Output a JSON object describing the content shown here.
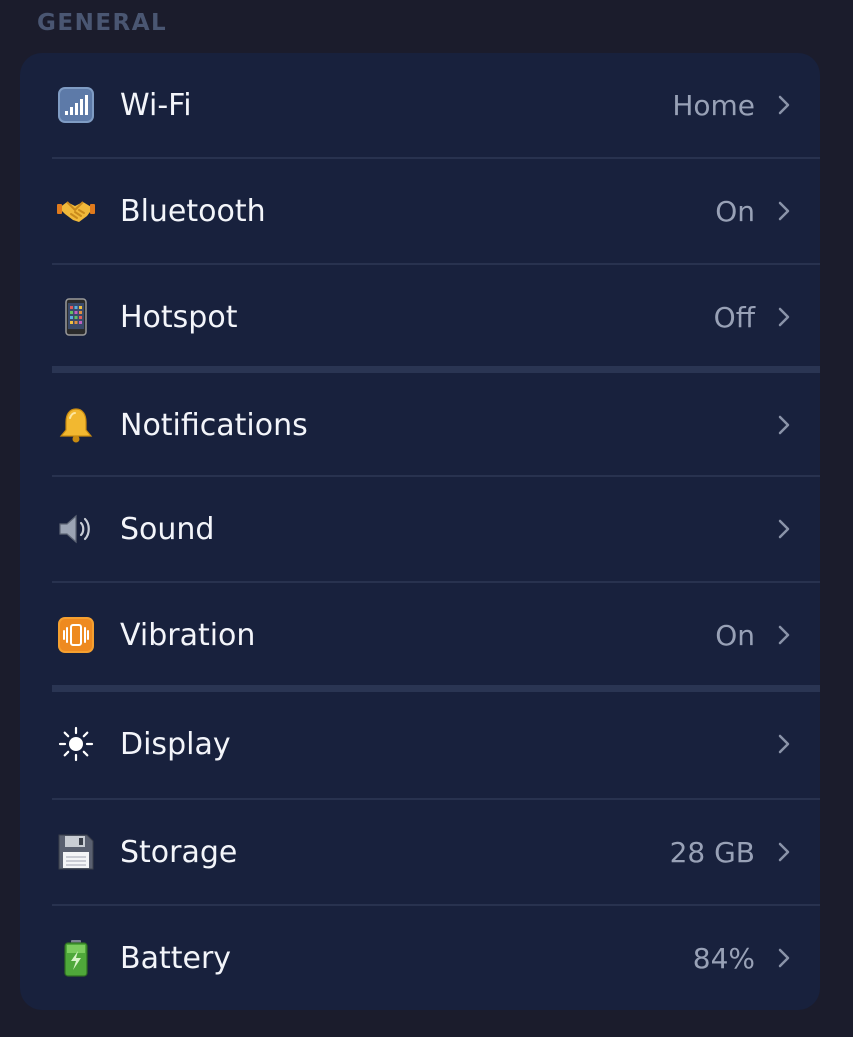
{
  "section": {
    "title": "GENERAL"
  },
  "items": [
    {
      "label": "Wi-Fi",
      "value": "Home",
      "icon": "wifi-signal-icon"
    },
    {
      "label": "Bluetooth",
      "value": "On",
      "icon": "handshake-icon"
    },
    {
      "label": "Hotspot",
      "value": "Off",
      "icon": "phone-icon"
    },
    {
      "label": "Notifications",
      "value": "",
      "icon": "bell-icon"
    },
    {
      "label": "Sound",
      "value": "",
      "icon": "speaker-icon"
    },
    {
      "label": "Vibration",
      "value": "On",
      "icon": "vibration-icon"
    },
    {
      "label": "Display",
      "value": "",
      "icon": "sun-icon"
    },
    {
      "label": "Storage",
      "value": "28 GB",
      "icon": "floppy-disk-icon"
    },
    {
      "label": "Battery",
      "value": "84%",
      "icon": "battery-icon"
    }
  ],
  "colors": {
    "background": "#1b1c2c",
    "card": "#18213d",
    "label": "#f3f5fa",
    "value": "#98a1b6",
    "header": "#4a5672"
  }
}
